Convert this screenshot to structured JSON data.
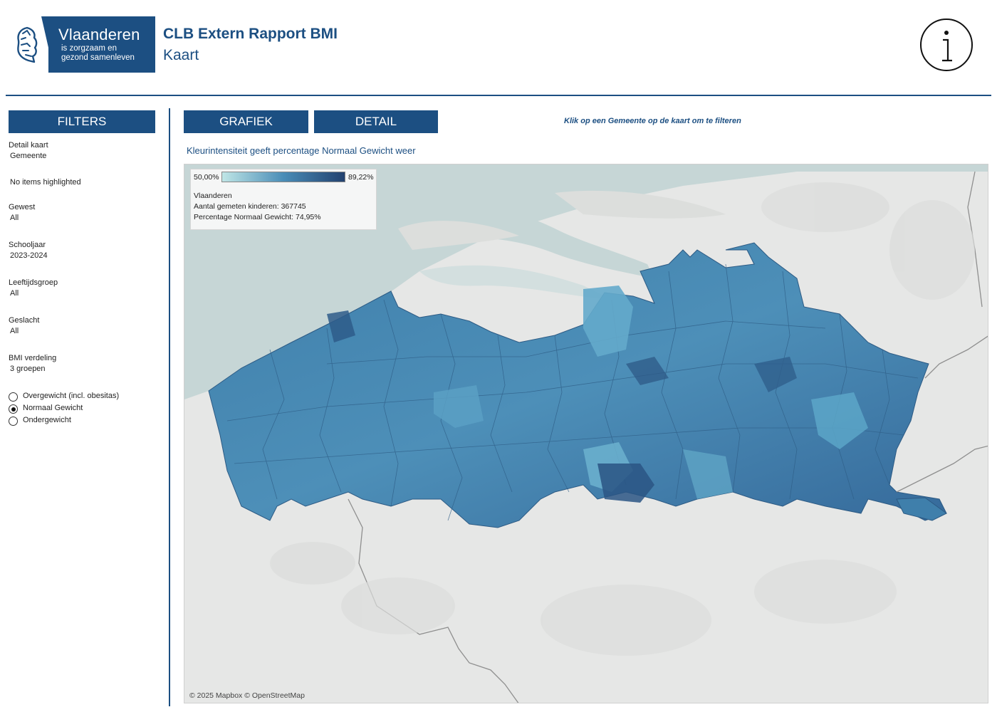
{
  "header": {
    "logo_brand": "Vlaanderen",
    "logo_tagline_1": "is zorgzaam en",
    "logo_tagline_2": "gezond samenleven",
    "title": "CLB Extern Rapport BMI",
    "subtitle": "Kaart",
    "info_icon": "info-circle-icon"
  },
  "filters": {
    "header": "FILTERS",
    "detail_kaart_label": "Detail kaart",
    "detail_kaart_value": "Gemeente",
    "highlight_text": "No items highlighted",
    "gewest_label": "Gewest",
    "gewest_value": "All",
    "schooljaar_label": "Schooljaar",
    "schooljaar_value": "2023-2024",
    "leeftijdsgroep_label": "Leeftijdsgroep",
    "leeftijdsgroep_value": "All",
    "geslacht_label": "Geslacht",
    "geslacht_value": "All",
    "bmi_label": "BMI verdeling",
    "bmi_value": "3 groepen",
    "radio_options": [
      {
        "label": "Overgewicht (incl. obesitas)",
        "selected": false
      },
      {
        "label": "Normaal Gewicht",
        "selected": true
      },
      {
        "label": "Ondergewicht",
        "selected": false
      }
    ]
  },
  "nav": {
    "grafiek": "GRAFIEK",
    "detail": "DETAIL",
    "hint": "Klik op een Gemeente op de kaart om te filteren"
  },
  "map": {
    "caption": "Kleurintensiteit geeft percentage Normaal Gewicht weer",
    "legend_min": "50,00%",
    "legend_max": "89,22%",
    "legend_region": "Vlaanderen",
    "legend_count": "Aantal gemeten kinderen: 367745",
    "legend_pct": "Percentage Normaal Gewicht: 74,95%",
    "attribution": "© 2025 Mapbox © OpenStreetMap",
    "colors": {
      "min": "#bfe6e6",
      "mid": "#4a8db7",
      "max": "#22416f",
      "sea": "#c6d6d6",
      "land": "#e6e7e6"
    }
  },
  "colors": {
    "brand": "#1c4f82"
  }
}
